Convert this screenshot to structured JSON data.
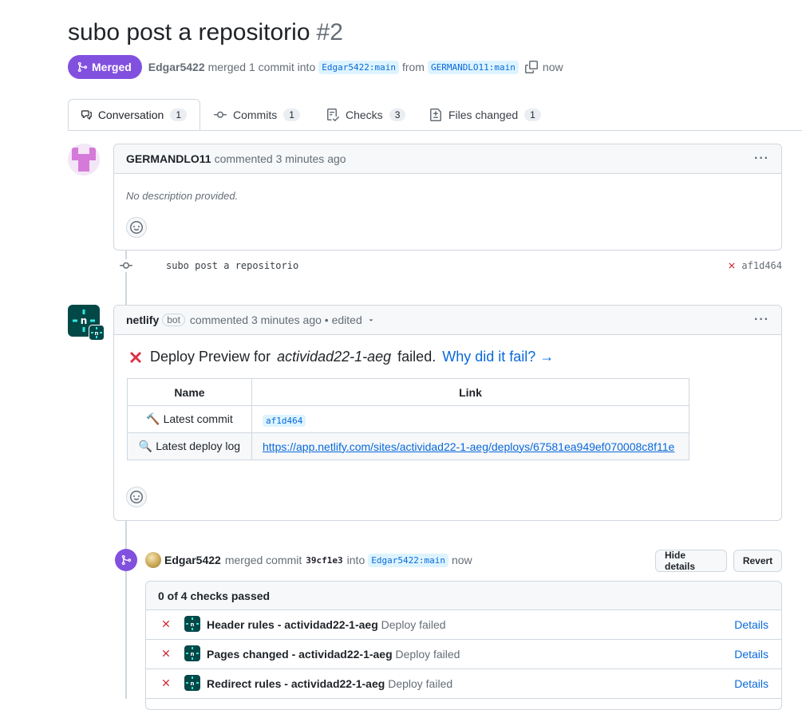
{
  "pr": {
    "title": "subo post a repositorio",
    "number": "#2",
    "state": "Merged",
    "author": "Edgar5422",
    "action": "merged 1 commit into",
    "base_branch": "Edgar5422:main",
    "from_text": "from",
    "head_branch": "GERMANDLO11:main",
    "time": "now"
  },
  "tabs": [
    {
      "label": "Conversation",
      "count": "1",
      "icon": "comment-discussion-icon"
    },
    {
      "label": "Commits",
      "count": "1",
      "icon": "git-commit-icon"
    },
    {
      "label": "Checks",
      "count": "3",
      "icon": "checklist-icon"
    },
    {
      "label": "Files changed",
      "count": "1",
      "icon": "file-diff-icon"
    }
  ],
  "comment1": {
    "author": "GERMANDLO11",
    "meta": "commented 3 minutes ago",
    "body": "No description provided.",
    "menu": "···"
  },
  "commit": {
    "message": "subo post a repositorio",
    "sha": "af1d464",
    "status": "failed"
  },
  "comment2": {
    "author": "netlify",
    "badge": "bot",
    "meta": "commented 3 minutes ago • edited",
    "menu": "···",
    "deploy_title_prefix": "Deploy Preview for",
    "deploy_site": "actividad22-1-aeg",
    "deploy_title_suffix": "failed.",
    "why_link": "Why did it fail? →",
    "table": {
      "headers": [
        "Name",
        "Link"
      ],
      "rows": [
        {
          "emoji": "🔨",
          "name": "Latest commit",
          "value": "af1d464"
        },
        {
          "emoji": "🔍",
          "name": "Latest deploy log",
          "value": "https://app.netlify.com/sites/actividad22-1-aeg/deploys/67581ea949ef070008c8f11e"
        }
      ]
    }
  },
  "merge": {
    "author": "Edgar5422",
    "text1": "merged commit",
    "sha": "39cf1e3",
    "text2": "into",
    "branch": "Edgar5422:main",
    "time": "now",
    "hide_details": "Hide details",
    "revert": "Revert"
  },
  "checks": {
    "summary": "0 of 4 checks passed",
    "rows": [
      {
        "name": "Header rules - actividad22-1-aeg",
        "status": "Deploy failed",
        "details": "Details"
      },
      {
        "name": "Pages changed - actividad22-1-aeg",
        "status": "Deploy failed",
        "details": "Details"
      },
      {
        "name": "Redirect rules - actividad22-1-aeg",
        "status": "Deploy failed",
        "details": "Details"
      }
    ]
  },
  "colors": {
    "merged_purple": "#8250df",
    "link_blue": "#0969da",
    "fail_red": "#cf222e",
    "netlify_teal": "#014847"
  }
}
